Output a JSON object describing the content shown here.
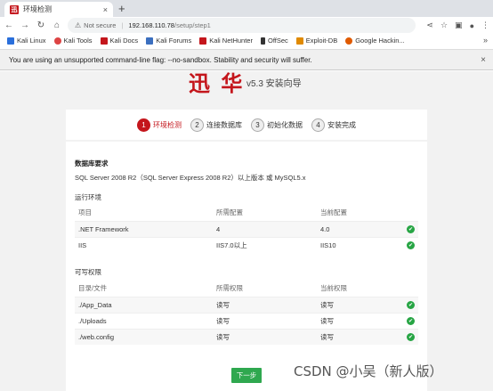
{
  "browser": {
    "tab_title": "环境检测",
    "tab_close": "×",
    "new_tab": "+",
    "favicon_text": "迅",
    "url_warning": "Not secure",
    "url_host": "192.168.110.78",
    "url_path": "/setup/step1",
    "infobar_text": "You are using an unsupported command-line flag: --no-sandbox. Stability and security will suffer.",
    "infobar_close": "×",
    "bookmarks_more": "»",
    "bookmarks": [
      {
        "label": "Kali Linux",
        "color": "#2a6fdb"
      },
      {
        "label": "Kali Tools",
        "color": "#d44"
      },
      {
        "label": "Kali Docs",
        "color": "#c4161c"
      },
      {
        "label": "Kali Forums",
        "color": "#3b6fbf"
      },
      {
        "label": "Kali NetHunter",
        "color": "#c4161c"
      },
      {
        "label": "OffSec",
        "color": "#333"
      },
      {
        "label": "Exploit-DB",
        "color": "#e08a00"
      },
      {
        "label": "Google Hackin...",
        "color": "#e05a00"
      }
    ]
  },
  "header": {
    "logo_text": "迅 华",
    "version": "v5.3 安装向导"
  },
  "steps": [
    {
      "num": "1",
      "label": "环境检测",
      "active": true
    },
    {
      "num": "2",
      "label": "连接数据库",
      "active": false
    },
    {
      "num": "3",
      "label": "初始化数据",
      "active": false
    },
    {
      "num": "4",
      "label": "安装完成",
      "active": false
    }
  ],
  "db": {
    "title": "数据库要求",
    "text": "SQL Server 2008 R2（SQL Server Express 2008 R2）以上版本 或 MySQL5.x"
  },
  "runtime": {
    "title": "运行环境",
    "headers": [
      "项目",
      "所需配置",
      "当前配置"
    ],
    "rows": [
      [
        "NET Framework",
        "4",
        "4.0"
      ],
      [
        "IIS",
        "IIS7.0以上",
        "IIS10"
      ]
    ]
  },
  "perms": {
    "title": "可写权限",
    "headers": [
      "目录/文件",
      "所需权限",
      "当前权限"
    ],
    "rows": [
      [
        "./App_Data",
        "读写",
        "读写"
      ],
      [
        "./Uploads",
        "读写",
        "读写"
      ],
      [
        "./web.config",
        "读写",
        "读写"
      ]
    ]
  },
  "next_label": "下一步",
  "watermark": "CSDN @小吴（新人版）",
  "colors": {
    "accent": "#c4161c",
    "ok": "#27a544",
    "button": "#2fa84f"
  }
}
